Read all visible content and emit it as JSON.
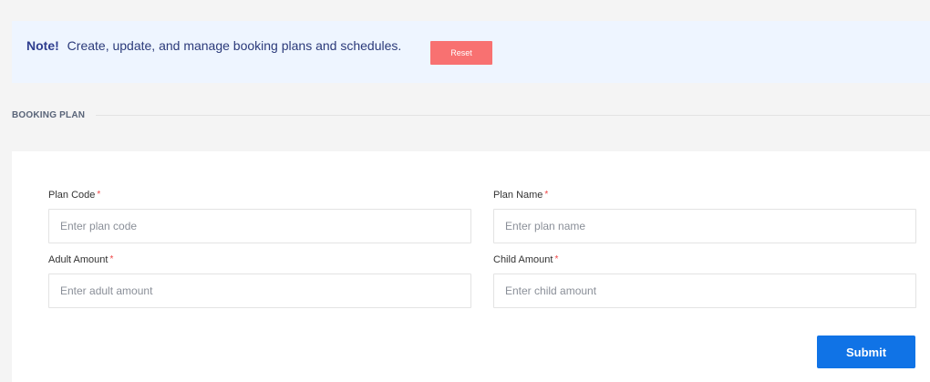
{
  "note": {
    "label": "Note!",
    "message": "Create, update, and manage booking plans and schedules.",
    "reset_label": "Reset"
  },
  "section": {
    "title": "BOOKING PLAN"
  },
  "form": {
    "required_mark": "*",
    "fields": [
      {
        "label": "Plan Code",
        "placeholder": "Enter plan code",
        "value": ""
      },
      {
        "label": "Plan Name",
        "placeholder": "Enter plan name",
        "value": ""
      },
      {
        "label": "Adult Amount",
        "placeholder": "Enter adult amount",
        "value": ""
      },
      {
        "label": "Child Amount",
        "placeholder": "Enter child amount",
        "value": ""
      }
    ],
    "submit_label": "Submit"
  },
  "colors": {
    "note_background": "#eef5ff",
    "reset_button": "#f87171",
    "submit_button": "#1073e6",
    "required_mark": "#ef4444"
  }
}
